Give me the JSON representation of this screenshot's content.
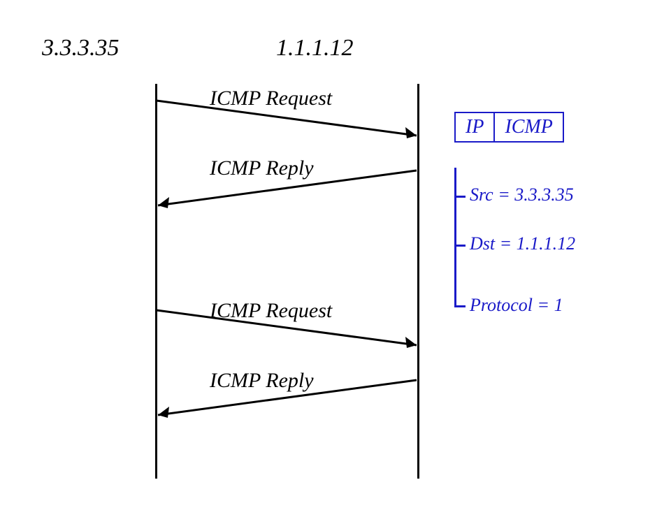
{
  "hosts": {
    "left": "3.3.3.35",
    "right": "1.1.1.12"
  },
  "messages": {
    "m1": "ICMP Request",
    "m2": "ICMP Reply",
    "m3": "ICMP Request",
    "m4": "ICMP Reply"
  },
  "packet": {
    "header1": "IP",
    "header2": "ICMP",
    "fields": {
      "src": "Src = 3.3.3.35",
      "dst": "Dst = 1.1.1.12",
      "proto": "Protocol = 1"
    }
  }
}
